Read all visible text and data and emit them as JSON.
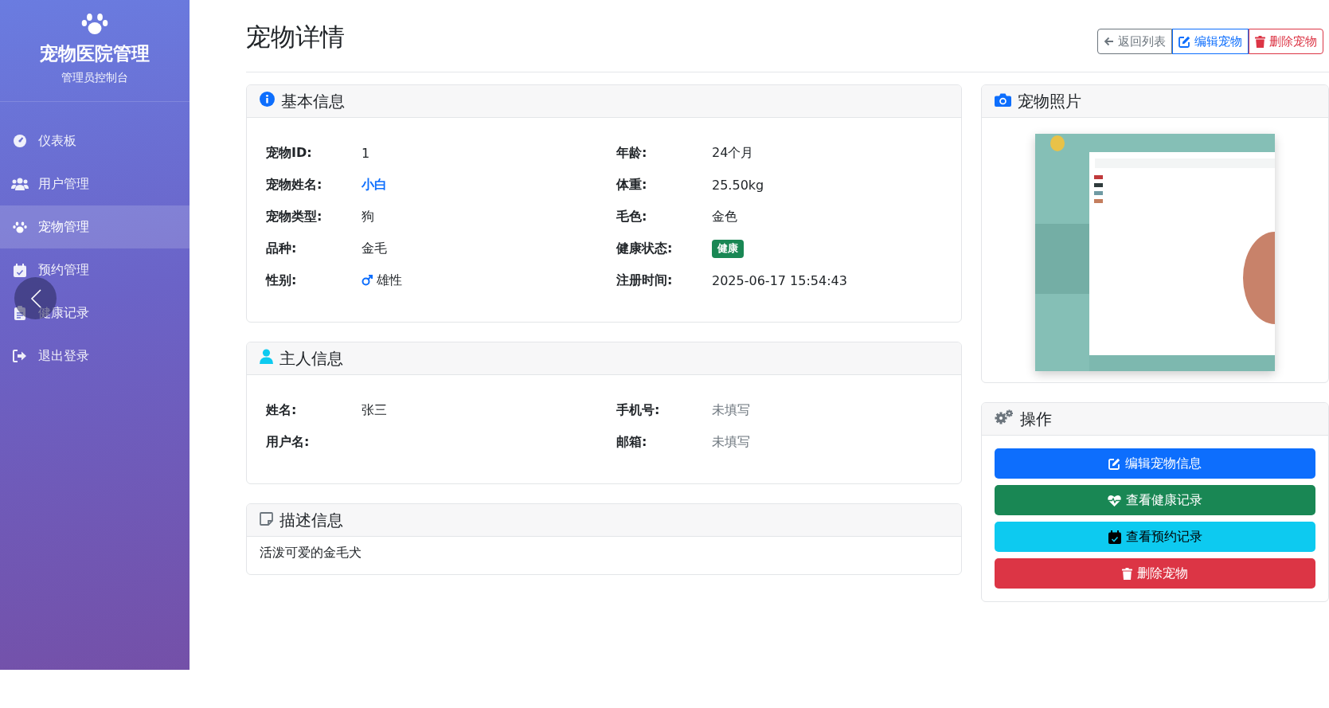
{
  "sidebar": {
    "brand": "宠物医院管理",
    "subtitle": "管理员控制台",
    "items": [
      {
        "label": "仪表板",
        "selected": false
      },
      {
        "label": "用户管理",
        "selected": false
      },
      {
        "label": "宠物管理",
        "selected": true
      },
      {
        "label": "预约管理",
        "selected": false
      },
      {
        "label": "健康记录",
        "selected": false
      },
      {
        "label": "退出登录",
        "selected": false
      }
    ]
  },
  "page": {
    "title": "宠物详情",
    "actions": [
      {
        "label": "返回列表",
        "kind": "secondary"
      },
      {
        "label": "编辑宠物",
        "kind": "primary"
      },
      {
        "label": "删除宠物",
        "kind": "danger"
      }
    ]
  },
  "basic_info": {
    "title": "基本信息",
    "fields": [
      {
        "label": "宠物ID:",
        "value": "1",
        "kind": "text"
      },
      {
        "label": "年龄:",
        "value": "24个月",
        "kind": "text"
      },
      {
        "label": "宠物姓名:",
        "value": "小白",
        "kind": "highlight"
      },
      {
        "label": "体重:",
        "value": "25.50kg",
        "kind": "text"
      },
      {
        "label": "宠物类型:",
        "value": "狗",
        "kind": "text"
      },
      {
        "label": "毛色:",
        "value": "金色",
        "kind": "text"
      },
      {
        "label": "品种:",
        "value": "金毛",
        "kind": "text"
      },
      {
        "label": "健康状态:",
        "value": "健康",
        "kind": "badge"
      },
      {
        "label": "性别:",
        "value": "雄性",
        "kind": "male"
      },
      {
        "label": "注册时间:",
        "value": "2025-06-17 15:54:43",
        "kind": "text"
      }
    ]
  },
  "owner_info": {
    "title": "主人信息",
    "fields": [
      {
        "label": "姓名:",
        "value": "张三",
        "kind": "text"
      },
      {
        "label": "手机号:",
        "value": "未填写",
        "kind": "muted"
      },
      {
        "label": "用户名:"
      },
      {
        "label": "邮箱:",
        "value": "未填写",
        "kind": "muted"
      }
    ]
  },
  "description": {
    "title": "描述信息",
    "text": "活泼可爱的金毛犬"
  },
  "photo": {
    "title": "宠物照片",
    "kind": "picture"
  },
  "operations": {
    "title": "操作",
    "buttons": [
      {
        "label": "编辑宠物信息",
        "kind": "primary"
      },
      {
        "label": "查看健康记录",
        "kind": "success"
      },
      {
        "label": "查看预约记录",
        "kind": "info"
      },
      {
        "label": "删除宠物",
        "kind": "danger"
      }
    ]
  }
}
